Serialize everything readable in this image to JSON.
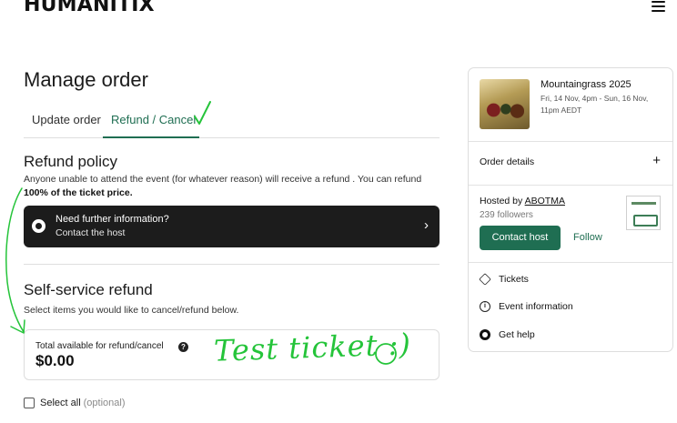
{
  "header": {
    "logo_text": "HUMANITIX",
    "menu_icon": "hamburger-menu-icon"
  },
  "page": {
    "title": "Manage order"
  },
  "tabs": [
    {
      "label": "Update order",
      "active": false
    },
    {
      "label": "Refund / Cancel",
      "active": true
    }
  ],
  "refund_policy": {
    "title": "Refund policy",
    "text": "Anyone unable to attend the event (for whatever reason) will receive a refund . You can refund",
    "bold_text": "100% of the ticket price."
  },
  "info_card": {
    "line1": "Need further information?",
    "line2": "Contact the host",
    "chevron": "›"
  },
  "self_service": {
    "title": "Self-service refund",
    "subtitle": "Select items you would like to cancel/refund below.",
    "total_label": "Total available for refund/cancel",
    "total_amount": "$0.00",
    "help_glyph": "?"
  },
  "select_all": {
    "label": "Select all",
    "optional": "(optional)",
    "checked": false
  },
  "handwritten_annotation": "Test ticket :)",
  "sidebar": {
    "event": {
      "title": "Mountaingrass 2025",
      "date": "Fri, 14 Nov, 4pm - Sun, 16 Nov, 11pm AEDT"
    },
    "order_details": "Order details",
    "order_plus": "+",
    "host": {
      "hosted_by": "Hosted by",
      "name": "ABOTMA",
      "followers": "239 followers",
      "contact_button": "Contact host",
      "follow_button": "Follow"
    },
    "links": [
      {
        "label": "Tickets",
        "icon": "tag-icon"
      },
      {
        "label": "Event information",
        "icon": "info-icon"
      },
      {
        "label": "Get help",
        "icon": "help-icon"
      }
    ]
  },
  "colors": {
    "accent": "#1f6e52",
    "annotation": "#25c43a",
    "dark_card": "#1c1c1c"
  }
}
